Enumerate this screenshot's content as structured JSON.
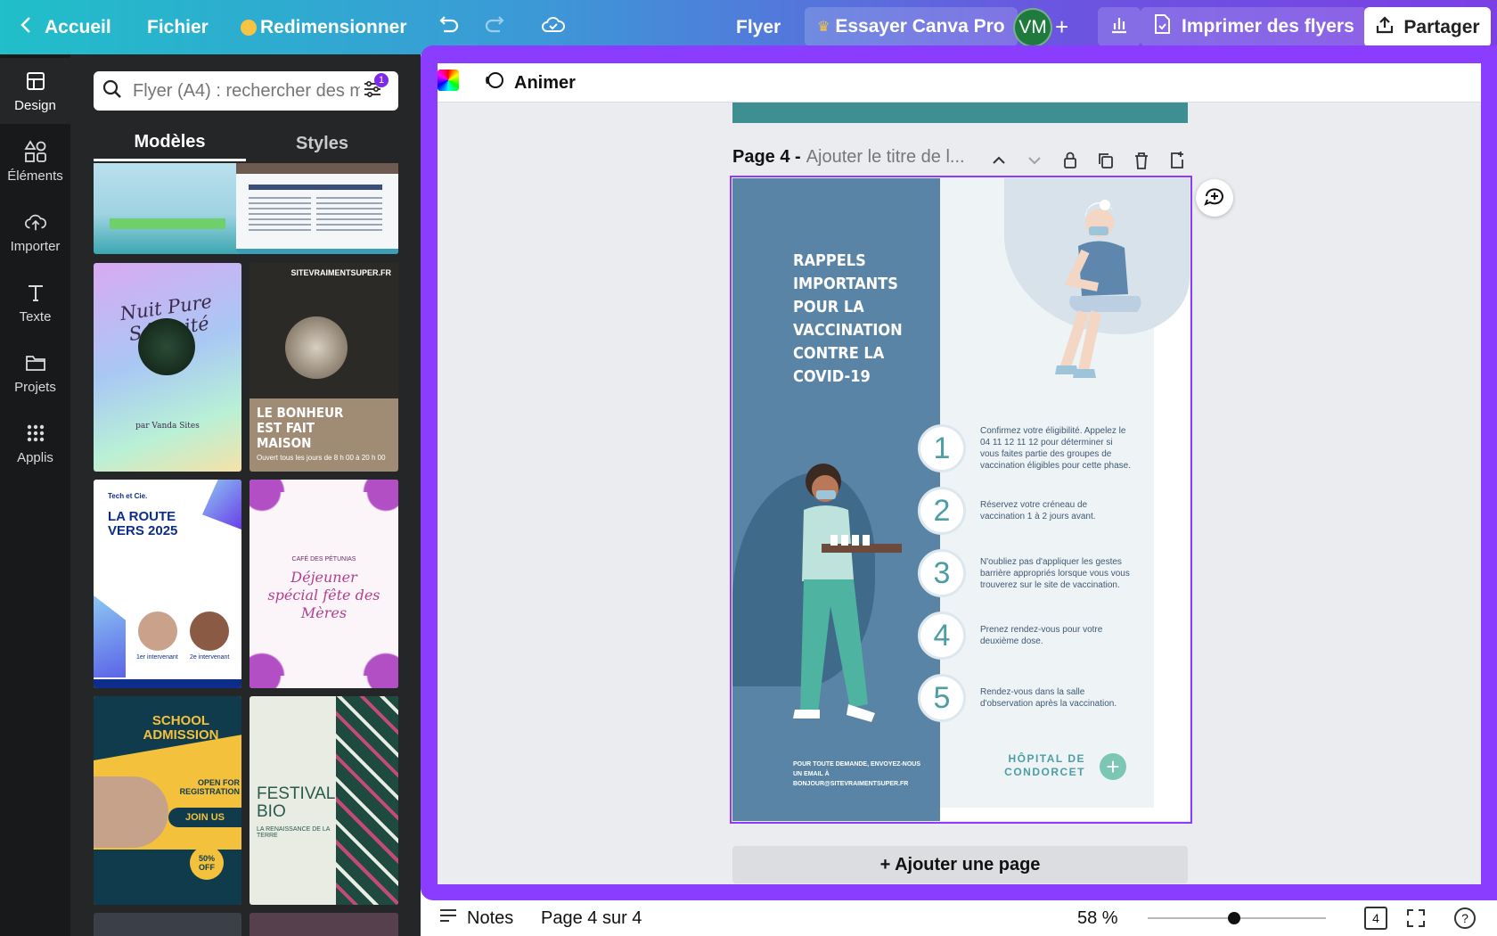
{
  "topbar": {
    "home_label": "Accueil",
    "file_label": "Fichier",
    "resize_label": "Redimensionner",
    "doc_type": "Flyer",
    "pro_label": "Essayer Canva Pro",
    "avatar_initials": "VM",
    "print_label": "Imprimer des flyers",
    "share_label": "Partager"
  },
  "rail": {
    "items": [
      {
        "label": "Design",
        "icon": "layout-icon"
      },
      {
        "label": "Éléments",
        "icon": "shapes-icon"
      },
      {
        "label": "Importer",
        "icon": "cloud-upload-icon"
      },
      {
        "label": "Texte",
        "icon": "text-icon"
      },
      {
        "label": "Projets",
        "icon": "folder-icon"
      },
      {
        "label": "Applis",
        "icon": "grid-icon"
      }
    ]
  },
  "panel": {
    "search_placeholder": "Flyer (A4) : rechercher des m",
    "filter_badge": "1",
    "tabs": [
      "Modèles",
      "Styles"
    ],
    "templates": [
      {
        "title": "Nuit Pure Sérénité",
        "subtitle": "par Vanda Sites"
      },
      {
        "title": "LE BONHEUR EST FAIT MAISON",
        "subtitle": "Ouvert tous les jours de 8 h 00 à 20 h 00",
        "brand": "SITEVRAIMENTSUPER.FR"
      },
      {
        "title": "LA ROUTE VERS 2025",
        "subtitle": "Tech et Cie.",
        "speaker1": "1er intervenant",
        "speaker2": "2e intervenant"
      },
      {
        "title": "Déjeuner spécial fête des Mères",
        "subtitle": "CAFÉ DES PÉTUNIAS"
      },
      {
        "title": "SCHOOL ADMISSION",
        "subtitle": "OPEN FOR REGISTRATION",
        "cta": "JOIN US",
        "discount": "50% OFF"
      },
      {
        "title": "FESTIVAL BIO",
        "subtitle": "LA RENAISSANCE DE LA TERRE"
      }
    ]
  },
  "subbar": {
    "animate_label": "Animer"
  },
  "page": {
    "label": "Page 4 -",
    "title_placeholder": "Ajouter le titre de l..."
  },
  "flyer": {
    "heading": "RAPPELS IMPORTANTS POUR LA VACCINATION CONTRE LA COVID-19",
    "steps": [
      {
        "num": "1",
        "text": "Confirmez votre éligibilité. Appelez le 04 11 12 11 12 pour déterminer si vous faites partie des groupes de vaccination éligibles pour cette phase."
      },
      {
        "num": "2",
        "text": "Réservez votre créneau de vaccination 1 à 2 jours avant."
      },
      {
        "num": "3",
        "text": "N'oubliez pas d'appliquer les gestes barrière appropriés lorsque vous vous trouverez sur le site de vaccination."
      },
      {
        "num": "4",
        "text": "Prenez rendez-vous pour votre deuxième dose."
      },
      {
        "num": "5",
        "text": "Rendez-vous dans la salle d'observation après la vaccination."
      }
    ],
    "contact": "POUR TOUTE DEMANDE, ENVOYEZ-NOUS UN EMAIL À BONJOUR@SITEVRAIMENTSUPER.FR",
    "hospital": "HÔPITAL DE CONDORCET"
  },
  "add_page_label": "+ Ajouter une page",
  "bottombar": {
    "notes_label": "Notes",
    "page_indicator": "Page 4 sur 4",
    "zoom": "58 %",
    "page_count": "4",
    "help": "?"
  },
  "colors": {
    "accent": "#8b3dff",
    "flyer_blue": "#5a84a6",
    "flyer_teal": "#4d9ea4"
  }
}
